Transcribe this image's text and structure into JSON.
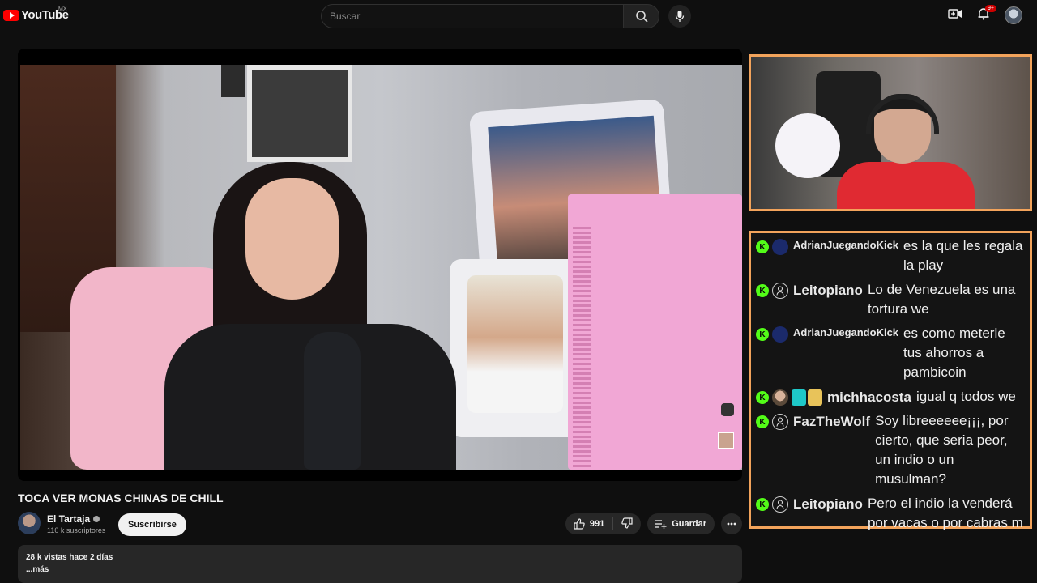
{
  "header": {
    "logo_text": "YouTube",
    "country_code": "MX",
    "search_placeholder": "Buscar",
    "notification_count": "9+"
  },
  "video": {
    "title": "TOCA VER MONAS CHINAS DE CHILL",
    "channel_name": "El Tartaja",
    "subscribers": "110 k suscriptores",
    "subscribe_label": "Suscribirse",
    "likes": "991",
    "save_label": "Guardar",
    "views_time": "28 k vistas  hace 2 días",
    "more_label": "...más",
    "player_badge": "1"
  },
  "chat": {
    "messages": [
      {
        "user": "AdrianJuegandoKick",
        "avatar": "blue",
        "size": "small",
        "text": "es la que les regala la play"
      },
      {
        "user": "Leitopiano",
        "avatar": "grey",
        "size": "big",
        "text": "Lo de Venezuela es una tortura we"
      },
      {
        "user": "AdrianJuegandoKick",
        "avatar": "blue",
        "size": "small",
        "text": "es como meterle tus ahorros a pambicoin"
      },
      {
        "user": "michhacosta",
        "avatar": "photo",
        "size": "big",
        "text": "igual q todos we",
        "emotes": true
      },
      {
        "user": "FazTheWolf",
        "avatar": "grey",
        "size": "big",
        "text": "Soy libreeeeee¡¡¡, por cierto, que seria peor, un indio o un musulman?"
      },
      {
        "user": "Leitopiano",
        "avatar": "grey",
        "size": "big",
        "text": "Pero el indio la venderá por vacas o por cabras m"
      }
    ]
  },
  "colors": {
    "accent_frame": "#f2a35b",
    "kick_green": "#53fc18",
    "youtube_red": "#ff0000"
  },
  "icons": [
    "youtube-logo-icon",
    "search-icon",
    "mic-icon",
    "create-video-icon",
    "bell-icon",
    "like-icon",
    "dislike-icon",
    "save-playlist-icon",
    "more-icon",
    "kick-icon",
    "user-icon"
  ]
}
